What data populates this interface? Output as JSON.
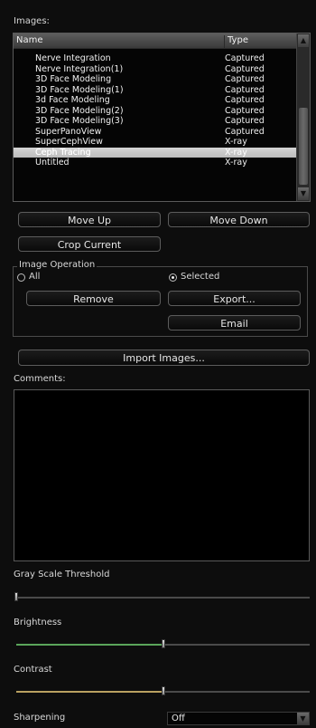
{
  "images": {
    "label": "Images:",
    "columns": {
      "name": "Name",
      "type": "Type"
    },
    "rows": [
      {
        "name": "Nerve Integration",
        "type": "Captured"
      },
      {
        "name": "Nerve Integration(1)",
        "type": "Captured"
      },
      {
        "name": "3D Face Modeling",
        "type": "Captured"
      },
      {
        "name": "3D Face Modeling(1)",
        "type": "Captured"
      },
      {
        "name": "3d Face Modeling",
        "type": "Captured"
      },
      {
        "name": "3D Face Modeling(2)",
        "type": "Captured"
      },
      {
        "name": "3D Face Modeling(3)",
        "type": "Captured"
      },
      {
        "name": "SuperPanoView",
        "type": "Captured"
      },
      {
        "name": "SuperCephView",
        "type": "X-ray"
      },
      {
        "name": "Ceph Tracing",
        "type": "X-ray",
        "selected": true
      },
      {
        "name": "Untitled",
        "type": "X-ray"
      }
    ],
    "scroll_up_icon": "triangle-up",
    "scroll_down_icon": "triangle-down"
  },
  "buttons": {
    "move_up": "Move Up",
    "move_down": "Move Down",
    "crop_current": "Crop Current",
    "remove": "Remove",
    "export": "Export...",
    "email": "Email",
    "import_images": "Import Images..."
  },
  "image_operation": {
    "title": "Image Operation",
    "all_label": "All",
    "selected_label": "Selected",
    "selected_option": "Selected"
  },
  "comments": {
    "label": "Comments:",
    "value": ""
  },
  "sliders": {
    "gray_scale_threshold": {
      "label": "Gray Scale Threshold",
      "value": 0.0
    },
    "brightness": {
      "label": "Brightness",
      "value": 0.5,
      "color": "#5aa55a"
    },
    "contrast": {
      "label": "Contrast",
      "value": 0.5,
      "color": "#b8a060"
    }
  },
  "sharpening": {
    "label": "Sharpening",
    "value": "Off"
  }
}
